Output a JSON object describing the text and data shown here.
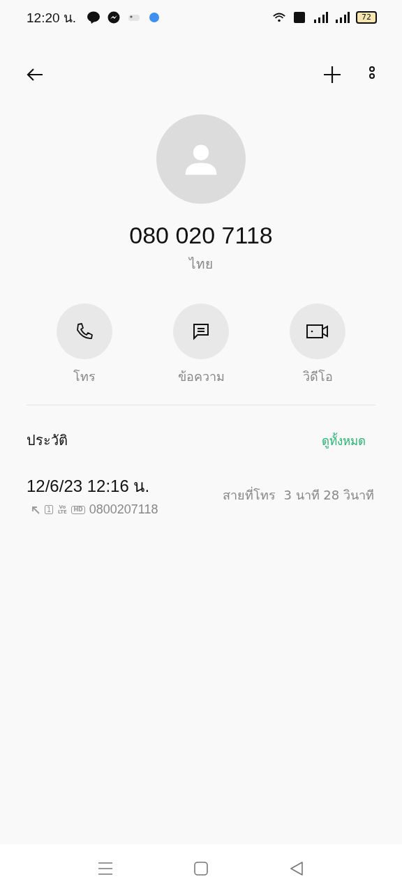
{
  "status_bar": {
    "time": "12:20 น.",
    "battery": "72"
  },
  "contact": {
    "number": "080 020 7118",
    "location": "ไทย"
  },
  "actions": [
    {
      "kind": "call",
      "label": "โทร"
    },
    {
      "kind": "message",
      "label": "ข้อความ"
    },
    {
      "kind": "video",
      "label": "วิดีโอ"
    }
  ],
  "history": {
    "title": "ประวัติ",
    "see_all": "ดูทั้งหมด",
    "entries": [
      {
        "datetime": "12/6/23 12:16 น.",
        "sim": "1",
        "volte": "Vo LTE",
        "hd": "HD",
        "number": "0800207118",
        "detail": "สายที่โทร  3 นาที 28 วินาที"
      }
    ]
  }
}
